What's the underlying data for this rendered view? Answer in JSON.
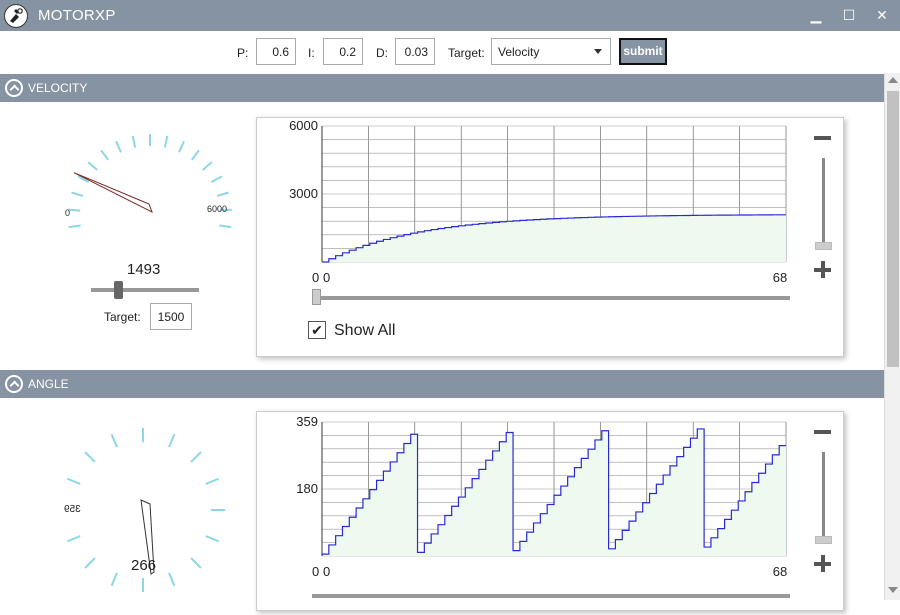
{
  "app": {
    "title": "MOTORXP"
  },
  "window": {
    "minimize": "▁",
    "maximize": "☐",
    "close": "✕"
  },
  "pid": {
    "p_label": "P:",
    "p_value": "0.6",
    "i_label": "I:",
    "i_value": "0.2",
    "d_label": "D:",
    "d_value": "0.03",
    "target_label": "Target:",
    "target_value": "Velocity",
    "submit_label": "submit"
  },
  "velocity": {
    "header": "VELOCITY",
    "gauge": {
      "min_label": "0",
      "max_label": "6000",
      "value": 1493,
      "max": 6000
    },
    "value_label": "1493",
    "slider_fraction": 0.25,
    "target_label": "Target:",
    "target_value": "1500",
    "chart": {
      "y_top": "6000",
      "y_mid": "3000",
      "y_bottom": "0",
      "x_left": "0",
      "x_right": "68"
    },
    "show_all_label": "Show All",
    "show_all_checked": true
  },
  "angle": {
    "header": "ANGLE",
    "gauge": {
      "left_label": "359",
      "value_label": "266",
      "value": 266,
      "max": 359
    },
    "chart": {
      "y_top": "359",
      "y_mid": "180",
      "y_bottom": "0",
      "x_left": "0",
      "x_right": "68"
    }
  },
  "colors": {
    "accent": "#8593a2",
    "line": "#2a2ad4",
    "fill": "#eefaf0",
    "tick": "#8dd6e6",
    "needle": "#7a2a2a"
  },
  "icons": {
    "logo": "motor-logo-icon",
    "collapse": "chevron-up-icon",
    "check": "checkmark-icon",
    "minus": "minus-icon",
    "plus": "plus-icon"
  }
}
